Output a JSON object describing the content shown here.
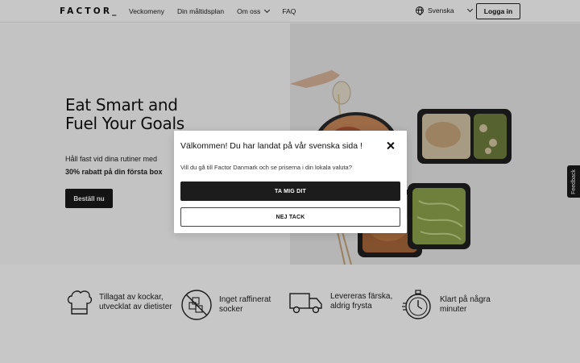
{
  "header": {
    "logo": "FACTOR_",
    "nav": [
      "Veckomeny",
      "Din måltidsplan",
      "Om oss",
      "FAQ"
    ],
    "language": "Svenska",
    "login_label": "Logga in"
  },
  "hero": {
    "title_line1": "Eat Smart and",
    "title_line2": "Fuel Your Goals",
    "subtitle_line1": "Håll fast vid dina rutiner med",
    "subtitle_line2": "30% rabatt på din första box",
    "cta_label": "Beställ nu"
  },
  "feedback_label": "Feedback",
  "features": [
    {
      "line1": "Tillagat av kockar,",
      "line2": "utvecklat av dietister",
      "icon": "chef-hat-icon"
    },
    {
      "line1": "Inget raffinerat",
      "line2": "socker",
      "icon": "no-sugar-icon"
    },
    {
      "line1": "Levereras färska,",
      "line2": "aldrig frysta",
      "icon": "delivery-truck-icon"
    },
    {
      "line1": "Klart på några",
      "line2": "minuter",
      "icon": "stopwatch-icon"
    }
  ],
  "modal": {
    "title": "Välkommen! Du har landat på vår svenska sida !",
    "text": "Vill du gå till Factor Danmark och se priserna i din lokala valuta?",
    "primary_label": "TA MIG DIT",
    "secondary_label": "NEJ TACK"
  },
  "colors": {
    "dark": "#1c1c1c",
    "overlay": "rgba(0,0,0,0.22)"
  }
}
